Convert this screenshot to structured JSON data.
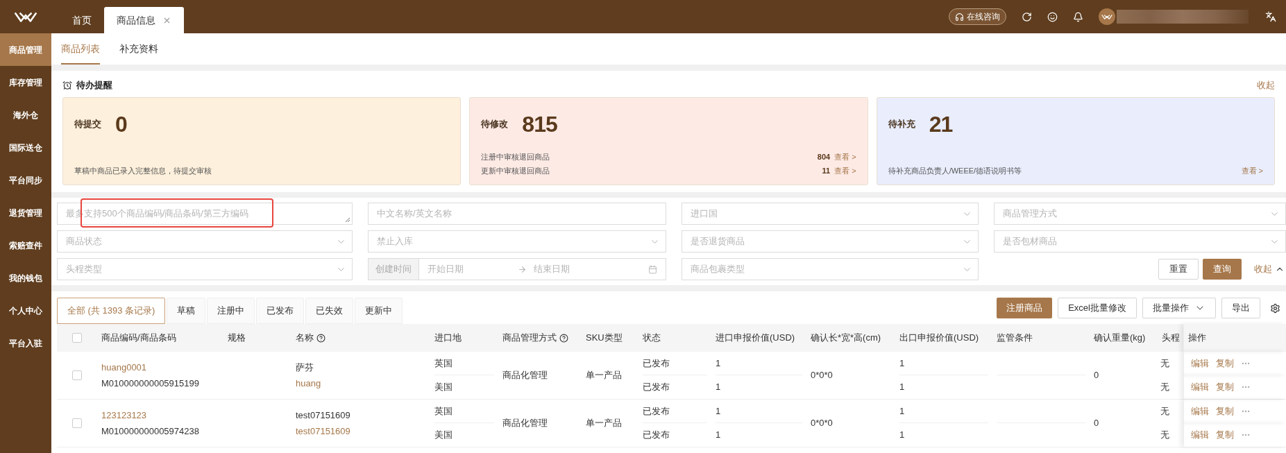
{
  "top_bar": {
    "tabs": [
      {
        "label": "首页",
        "selected": false,
        "closable": false
      },
      {
        "label": "商品信息",
        "selected": true,
        "closable": true
      }
    ],
    "consult_button": "在线咨询"
  },
  "sidebar": {
    "items": [
      {
        "label": "商品管理",
        "selected": true
      },
      {
        "label": "库存管理",
        "selected": false
      },
      {
        "label": "海外仓",
        "selected": false
      },
      {
        "label": "国际送仓",
        "selected": false
      },
      {
        "label": "平台同步",
        "selected": false
      },
      {
        "label": "退货管理",
        "selected": false
      },
      {
        "label": "索赔查件",
        "selected": false
      },
      {
        "label": "我的钱包",
        "selected": false
      },
      {
        "label": "个人中心",
        "selected": false
      },
      {
        "label": "平台入驻",
        "selected": false
      }
    ]
  },
  "sub_tabs": [
    {
      "label": "商品列表",
      "selected": true
    },
    {
      "label": "补充资料",
      "selected": false
    }
  ],
  "todo": {
    "title": "待办提醒",
    "collapse": "收起",
    "cards": [
      {
        "label": "待提交",
        "count": "0",
        "color": "#fdf0dc",
        "lines": [
          {
            "text": "草稿中商品已录入完整信息，待提交审核"
          }
        ]
      },
      {
        "label": "待修改",
        "count": "815",
        "color": "#fdeae5",
        "lines": [
          {
            "text": "注册中审核退回商品",
            "count": "804",
            "link": "查看 >"
          },
          {
            "text": "更新中审核退回商品",
            "count": "11",
            "link": "查看 >"
          }
        ]
      },
      {
        "label": "待补充",
        "count": "21",
        "color": "#e9edfc",
        "lines": [
          {
            "text": "待补充商品负责人/WEEE/德语说明书等",
            "link": "查看 >"
          }
        ]
      }
    ]
  },
  "filters": {
    "fields": [
      {
        "kind": "textarea",
        "placeholder": "最多支持500个商品编码/商品条码/第三方编码",
        "highlighted": true
      },
      {
        "kind": "input",
        "placeholder": "中文名称/英文名称"
      },
      {
        "kind": "select",
        "placeholder": "进口国"
      },
      {
        "kind": "select",
        "placeholder": "商品管理方式"
      },
      {
        "kind": "select",
        "placeholder": "商品状态"
      },
      {
        "kind": "select",
        "placeholder": "禁止入库"
      },
      {
        "kind": "select",
        "placeholder": "是否退货商品"
      },
      {
        "kind": "select",
        "placeholder": "是否包材商品"
      },
      {
        "kind": "select",
        "placeholder": "头程类型"
      },
      {
        "kind": "daterange",
        "label": "创建时间",
        "start": "开始日期",
        "end": "结束日期"
      },
      {
        "kind": "select",
        "placeholder": "商品包裹类型"
      }
    ],
    "reset_button": "重置",
    "search_button": "查询",
    "collapse": "收起"
  },
  "status_tabs": [
    {
      "label": "全部 (共 1393 条记录)",
      "selected": true
    },
    {
      "label": "草稿",
      "selected": false
    },
    {
      "label": "注册中",
      "selected": false
    },
    {
      "label": "已发布",
      "selected": false
    },
    {
      "label": "已失效",
      "selected": false
    },
    {
      "label": "更新中",
      "selected": false
    }
  ],
  "actions": [
    {
      "kind": "primary",
      "label": "注册商品"
    },
    {
      "kind": "plain",
      "label": "Excel批量修改"
    },
    {
      "kind": "dropdown",
      "label": "批量操作"
    },
    {
      "kind": "plain",
      "label": "导出"
    }
  ],
  "table": {
    "select_all": {
      "checked": false
    },
    "columns": [
      {
        "label": "商品编码/商品条码",
        "help": false
      },
      {
        "label": "规格",
        "help": false
      },
      {
        "label": "名称",
        "help": true
      },
      {
        "label": "进口地",
        "help": false
      },
      {
        "label": "商品管理方式",
        "help": true
      },
      {
        "label": "SKU类型",
        "help": false
      },
      {
        "label": "状态",
        "help": false
      },
      {
        "label": "进口申报价值(USD)",
        "help": false
      },
      {
        "label": "确认长*宽*高(cm)",
        "help": false
      },
      {
        "label": "出口申报价值(USD)",
        "help": false
      },
      {
        "label": "监管条件",
        "help": false
      },
      {
        "label": "确认重量(kg)",
        "help": false
      },
      {
        "label": "头程",
        "help": false
      },
      {
        "label": "操作",
        "help": false
      }
    ],
    "rows": [
      {
        "checked": false,
        "code": "huang0001",
        "barcode": "M010000000005915199",
        "name": "萨芬",
        "name_en": "huang",
        "management": "商品化管理",
        "sku_type": "单一产品",
        "dimensions": "0*0*0",
        "weight": "0",
        "lines": [
          {
            "origin": "英国",
            "status": "已发布",
            "import_value": "1",
            "export_value": "1",
            "first_leg": "无",
            "actions": [
              "编辑",
              "复制"
            ]
          },
          {
            "origin": "美国",
            "status": "已发布",
            "import_value": "1",
            "export_value": "1",
            "first_leg": "无",
            "actions": [
              "编辑",
              "复制"
            ]
          }
        ]
      },
      {
        "checked": false,
        "code": "123123123",
        "barcode": "M010000000005974238",
        "name": "test07151609",
        "name_en": "test07151609",
        "management": "商品化管理",
        "sku_type": "单一产品",
        "dimensions": "0*0*0",
        "weight": "0",
        "lines": [
          {
            "origin": "英国",
            "status": "已发布",
            "import_value": "1",
            "export_value": "1",
            "first_leg": "无",
            "actions": [
              "编辑",
              "复制"
            ]
          },
          {
            "origin": "美国",
            "status": "已发布",
            "import_value": "1",
            "export_value": "1",
            "first_leg": "无",
            "actions": [
              "编辑",
              "复制"
            ]
          }
        ]
      }
    ]
  }
}
